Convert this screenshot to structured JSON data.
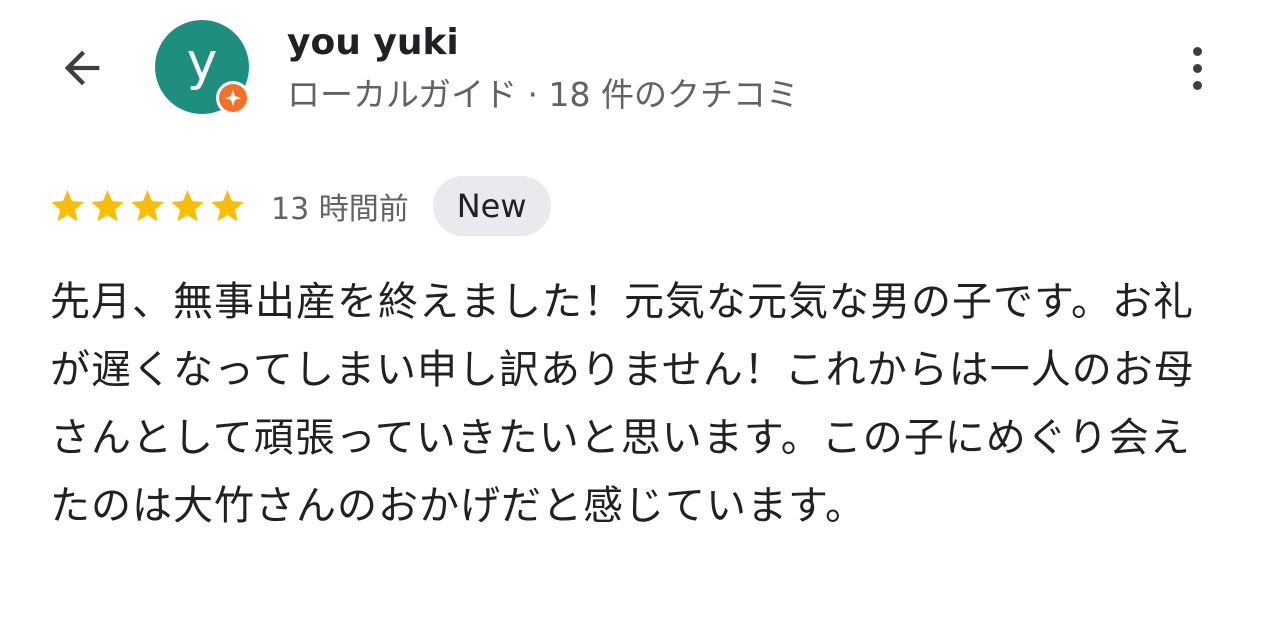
{
  "header": {
    "back_icon": "arrow-back-icon",
    "more_icon": "more-vert-icon"
  },
  "user": {
    "avatar_letter": "y",
    "avatar_color": "#1e8e7e",
    "badge_color": "#f4702a",
    "badge_icon": "local-guide-star-icon",
    "name": "you yuki",
    "meta": "ローカルガイド · 18 件のクチコミ"
  },
  "review": {
    "rating": 5,
    "rating_max": 5,
    "star_color": "#fbbc04",
    "time_ago": "13 時間前",
    "badge": "New",
    "text": "先月、無事出産を終えました！元気な元気な男の子です。お礼が遅くなってしまい申し訳ありません！これからは一人のお母さんとして頑張っていきたいと思います。この子にめぐり会えたのは大竹さんのおかげだと感じています。"
  }
}
